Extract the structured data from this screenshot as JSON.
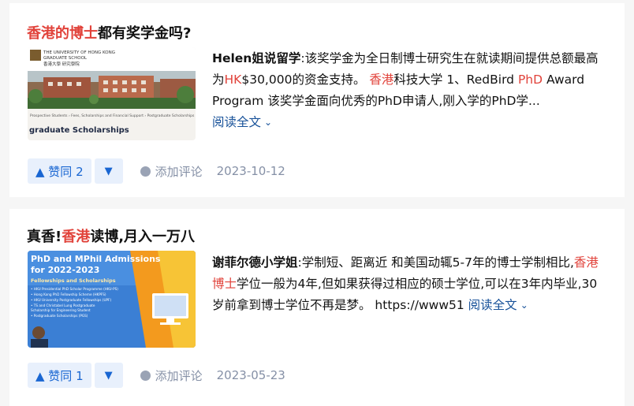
{
  "articles": [
    {
      "title_hl": "香港的博士",
      "title_rest": "都有奖学金吗?",
      "author": "Helen姐说留学",
      "excerpt_1": ":该奖学金为全日制博士研究生在就读期间提供总额最高为",
      "excerpt_hl_1": "HK",
      "excerpt_2": "$30,000的资金支持。 ",
      "excerpt_hl_2": "香港",
      "excerpt_3": "科技大学 1、RedBird ",
      "excerpt_hl_3": "PhD",
      "excerpt_4": " Award Program 该奖学金面向优秀的PhD申请人,刚入学的PhD学...",
      "read_more": "阅读全文",
      "vote_up": "▲ 赞同 2",
      "vote_down": "▼",
      "comment": "添加评论",
      "date": "2023-10-12",
      "thumb": {
        "header_line_1": "THE UNIVERSITY OF HONG KONG",
        "header_line_2": "GRADUATE SCHOOL",
        "header_line_3": "香港大學 研究學院",
        "breadcrumb": "Prospective Students › Fees, Scholarships and Financial Support › Postgraduate Scholarships",
        "caption": "graduate Scholarships"
      }
    },
    {
      "title_pre": "真香!",
      "title_hl": "香港",
      "title_rest": "读博,月入一万八",
      "author": "谢菲尔德小学姐",
      "excerpt_1": ":学制短、距离近 和美国动辄5-7年的博士学制相比,",
      "excerpt_hl_1": "香港博士",
      "excerpt_2": "学位一般为4年,但如果获得过相应的硕士学位,可以在3年内毕业,30岁前拿到博士学位不再是梦。 https://www51 ",
      "read_more": "阅读全文",
      "vote_up": "▲ 赞同 1",
      "vote_down": "▼",
      "comment": "添加评论",
      "date": "2023-05-23",
      "thumb": {
        "heading_line_1": "PhD and MPhil Admissions",
        "heading_line_2": "for 2022-2023",
        "subheading": "Fellowships and Scholarships",
        "items": [
          "• HKU Presidential PhD Scholar Programme (HKU-PS)",
          "• Hong Kong PhD Fellowship Scheme (HKPFS)",
          "• HKU University Postgraduate Fellowships (UPF)",
          "• TS and Christabel Lung Postgraduate",
          "  Scholarship for Engineering Student",
          "• Postgraduate Scholarships (PGS)"
        ]
      }
    }
  ]
}
